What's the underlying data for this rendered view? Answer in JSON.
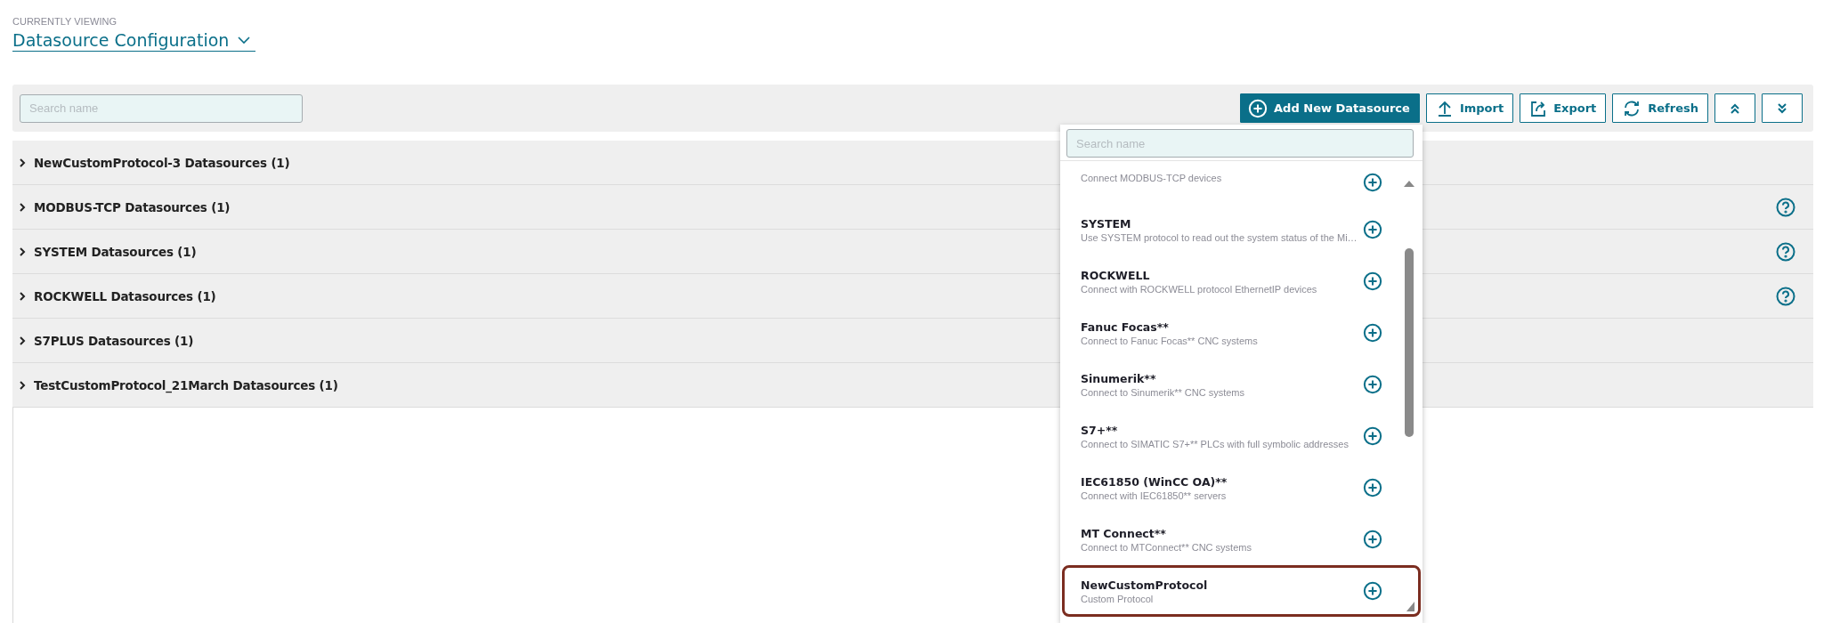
{
  "header": {
    "caption": "CURRENTLY VIEWING",
    "title": "Datasource Configuration"
  },
  "toolbar": {
    "search": {
      "placeholder": "Search name"
    },
    "buttons": [
      {
        "kind": "add",
        "label": "Add New Datasource"
      },
      {
        "kind": "import",
        "label": "Import"
      },
      {
        "kind": "export",
        "label": "Export"
      },
      {
        "kind": "refresh",
        "label": "Refresh"
      },
      {
        "kind": "collapse_all"
      },
      {
        "kind": "expand_all"
      }
    ]
  },
  "groups": [
    {
      "label": "NewCustomProtocol-3 Datasources (1)",
      "expanded": false,
      "help": false
    },
    {
      "label": "MODBUS-TCP Datasources (1)",
      "expanded": false,
      "help": true
    },
    {
      "label": "SYSTEM Datasources (1)",
      "expanded": false,
      "help": true
    },
    {
      "label": "ROCKWELL Datasources (1)",
      "expanded": false,
      "help": true
    },
    {
      "label": "S7PLUS Datasources (1)",
      "expanded": false,
      "help": false
    },
    {
      "label": "TestCustomProtocol_21March Datasources (1)",
      "expanded": false,
      "help": false
    }
  ],
  "dropdown": {
    "search": {
      "placeholder": "Search name"
    },
    "items": [
      {
        "description": "Connect MODBUS-TCP devices",
        "selected": false
      },
      {
        "title": "SYSTEM",
        "description": "Use SYSTEM protocol to read out the system status of the Mi…",
        "selected": false
      },
      {
        "title": "ROCKWELL",
        "description": "Connect with ROCKWELL protocol EthernetIP devices",
        "selected": false
      },
      {
        "title": "Fanuc Focas**",
        "description": "Connect to Fanuc Focas** CNC systems",
        "selected": false
      },
      {
        "title": "Sinumerik**",
        "description": "Connect to Sinumerik** CNC systems",
        "selected": false
      },
      {
        "title": "S7+**",
        "description": "Connect to SIMATIC S7+** PLCs with full symbolic addresses",
        "selected": false
      },
      {
        "title": "IEC61850 (WinCC OA)**",
        "description": "Connect with IEC61850** servers",
        "selected": false
      },
      {
        "title": "MT Connect**",
        "description": "Connect to MTConnect** CNC systems",
        "selected": false
      },
      {
        "title": "NewCustomProtocol",
        "description": "Custom Protocol",
        "selected": true
      }
    ]
  }
}
